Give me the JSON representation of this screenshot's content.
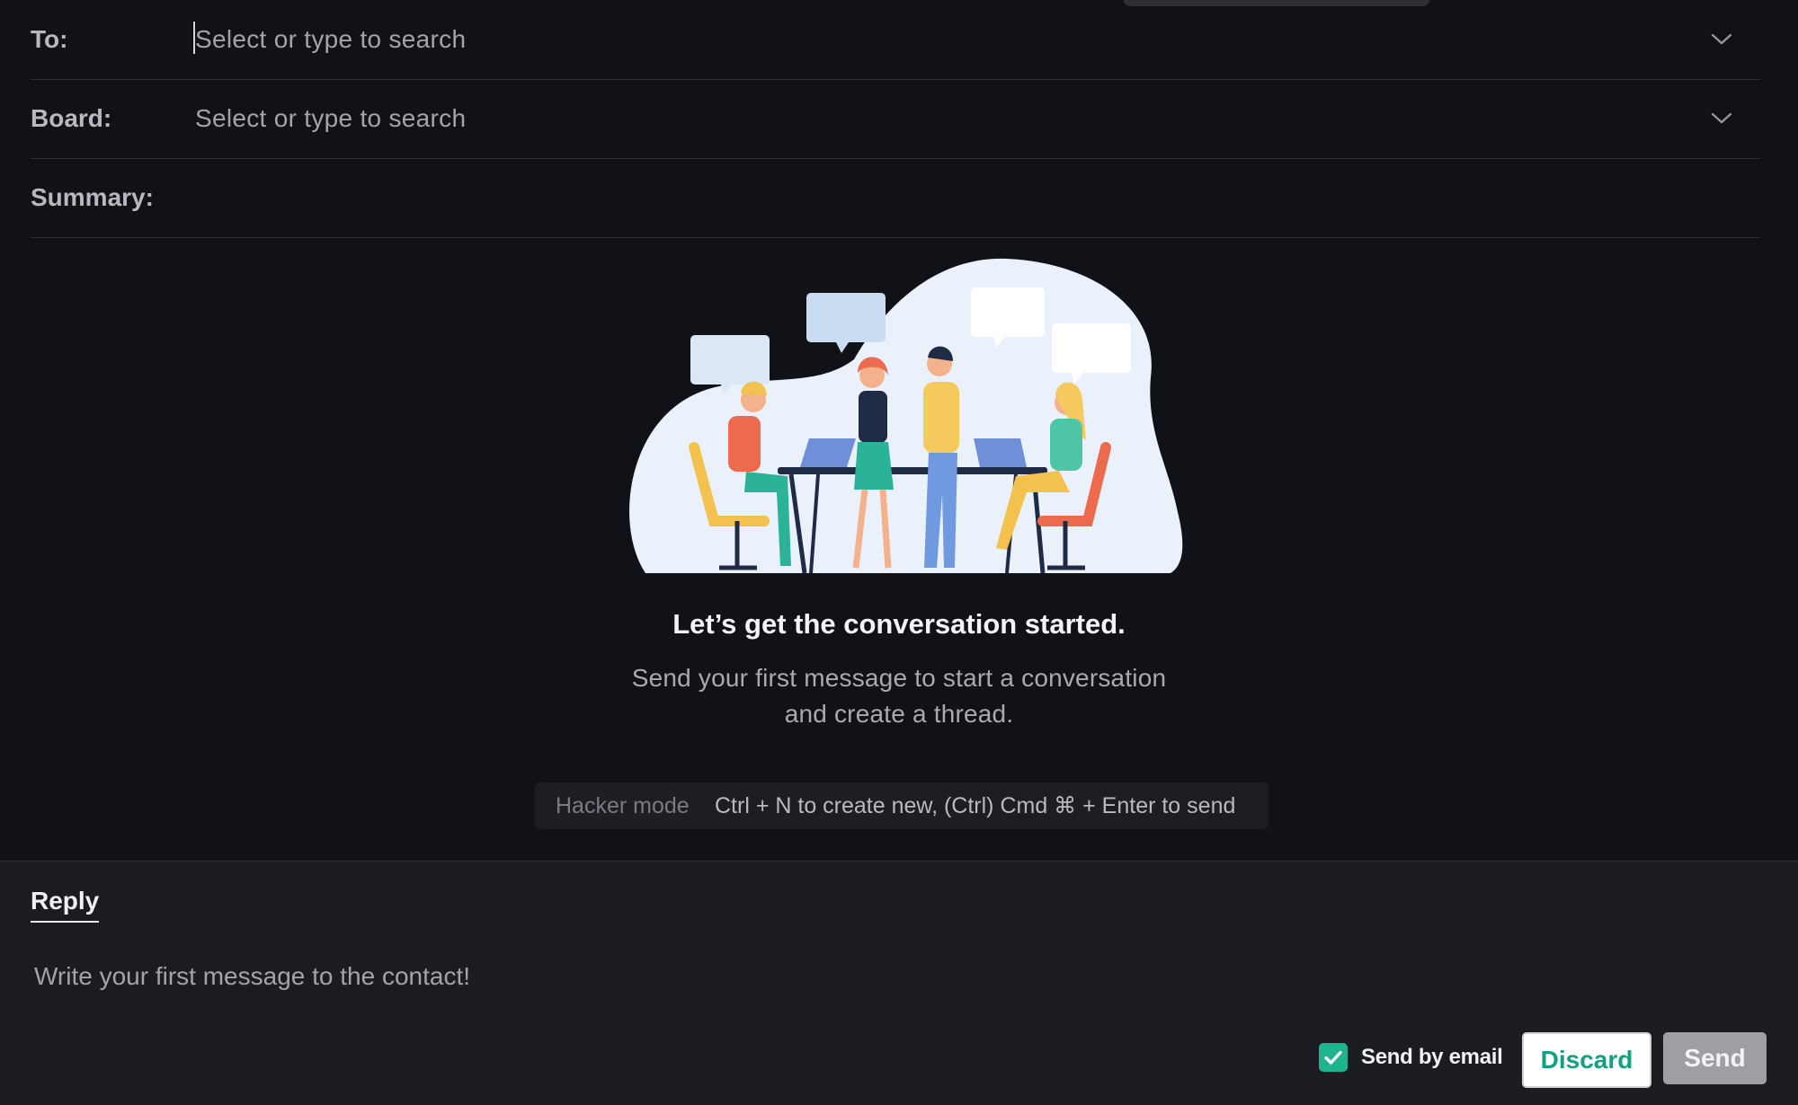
{
  "form": {
    "to_label": "To:",
    "to_placeholder": "Select or type to search",
    "board_label": "Board:",
    "board_placeholder": "Select or type to search",
    "summary_label": "Summary:"
  },
  "empty_state": {
    "headline": "Let’s get the conversation started.",
    "subline_1": "Send your first message to start a conversation",
    "subline_2": "and create a thread.",
    "hint_mode": "Hacker mode",
    "hint_shortcut": "Ctrl + N to create new, (Ctrl) Cmd ⌘ + Enter to send"
  },
  "reply": {
    "tab_label": "Reply",
    "placeholder": "Write your first message to the contact!",
    "send_by_email_label": "Send by email",
    "send_by_email_checked": true,
    "discard_label": "Discard",
    "send_label": "Send"
  },
  "icons": {
    "to_dropdown": "chevron-down-icon",
    "board_dropdown": "chevron-down-icon",
    "checkbox": "checkmark-icon"
  },
  "colors": {
    "background": "#111217",
    "panel": "#1b1c21",
    "accent_green": "#1fb38e",
    "discard_text": "#14a07f",
    "send_disabled": "#9e9ea3"
  }
}
